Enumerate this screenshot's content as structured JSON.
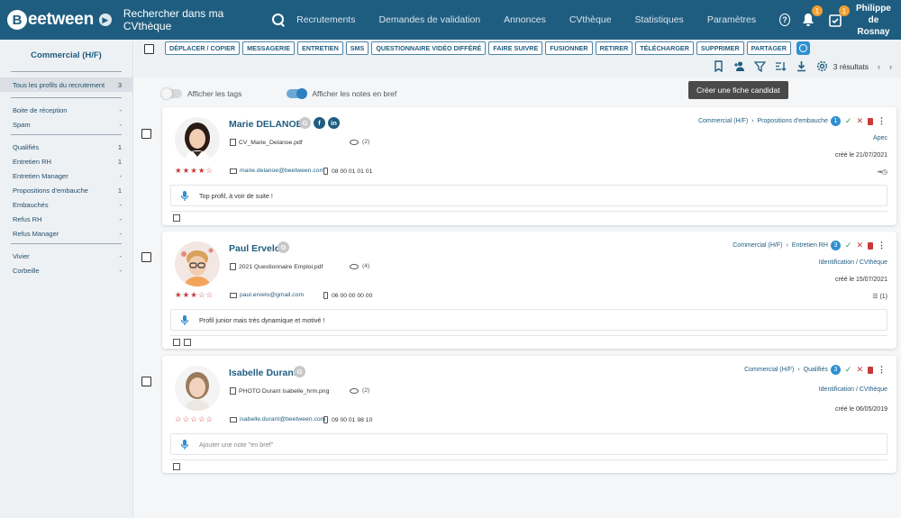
{
  "header": {
    "logo_letter": "B",
    "logo_text": "eetween",
    "search_label": "Rechercher dans ma CVthèque",
    "nav": [
      "Recrutements",
      "Demandes de validation",
      "Annonces",
      "CVthèque",
      "Statistiques",
      "Paramètres"
    ],
    "notifications_count": "1",
    "tasks_count": "1",
    "user_first": "Philippe",
    "user_last": "de Rosnay"
  },
  "sidebar": {
    "title": "Commercial (H/F)",
    "groups": [
      [
        {
          "label": "Tous les profils du recrutement",
          "count": "3",
          "active": true
        }
      ],
      [
        {
          "label": "Boite de réception",
          "count": "-"
        },
        {
          "label": "Spam",
          "count": "-"
        }
      ],
      [
        {
          "label": "Qualifiés",
          "count": "1"
        },
        {
          "label": "Entretien RH",
          "count": "1"
        },
        {
          "label": "Entretien Manager",
          "count": "-"
        },
        {
          "label": "Propositions d'embauche",
          "count": "1"
        },
        {
          "label": "Embauchés",
          "count": "-"
        },
        {
          "label": "Refus RH",
          "count": "-"
        },
        {
          "label": "Refus Manager",
          "count": "-"
        }
      ],
      [
        {
          "label": "Vivier",
          "count": "-"
        },
        {
          "label": "Corbeille",
          "count": "-"
        }
      ]
    ]
  },
  "toolbar": {
    "actions": [
      "DÉPLACER / COPIER",
      "MESSAGERIE",
      "ENTRETIEN",
      "SMS",
      "QUESTIONNAIRE VIDÉO DIFFÉRÉ",
      "FAIRE SUIVRE",
      "FUSIONNER",
      "RETIRER",
      "TÉLÉCHARGER",
      "SUPPRIMER",
      "PARTAGER"
    ],
    "results": "3 résultats",
    "tooltip": "Créer une fiche candidat"
  },
  "toggles": {
    "tags_label": "Afficher les tags",
    "notes_label": "Afficher les notes en bref"
  },
  "candidates": [
    {
      "name": "Marie DELANOE",
      "file": "CV_Marie_Delanoe.pdf",
      "views": "(2)",
      "stars": "★★★★☆",
      "email": "marie.delanoe@beetween.com",
      "phone": "08 00 01 01 01",
      "note": "Top profil, à voir de suite !",
      "pipeline_job": "Commercial (H/F)",
      "pipeline_step": "Propositions d'embauche",
      "step_number": "1",
      "source": "Apec",
      "created": "créé le 21/07/2021",
      "extra": "⇥◷",
      "socials": [
        "G",
        "f",
        "in"
      ]
    },
    {
      "name": "Paul Ervelo",
      "file": "2021 Questionnaire Emploi.pdf",
      "views": "(4)",
      "stars": "★★★☆☆",
      "email": "paul.ervelo@gmail.com",
      "phone": "06 00 00 00 00",
      "note": "Profil junior mais très dynamique et motivé !",
      "pipeline_job": "Commercial (H/F)",
      "pipeline_step": "Entretien RH",
      "step_number": "3",
      "source": "Identification / CVthèque",
      "created": "créé le 15/07/2021",
      "extra": "☰ (1)",
      "socials": [
        "G"
      ]
    },
    {
      "name": "Isabelle Durant",
      "file": "PHOTO Durant Isabelle_hrm.png",
      "views": "(2)",
      "stars": "☆☆☆☆☆",
      "email": "isabelle.durant@beetween.com",
      "phone": "09 00 01 98 10",
      "note": "Ajouter une note \"en bref\"",
      "pipeline_job": "Commercial (H/F)",
      "pipeline_step": "Qualifiés",
      "step_number": "3",
      "source": "Identification / CVthèque",
      "created": "créé le 06/05/2019",
      "extra": "",
      "socials": [
        "G"
      ]
    }
  ]
}
